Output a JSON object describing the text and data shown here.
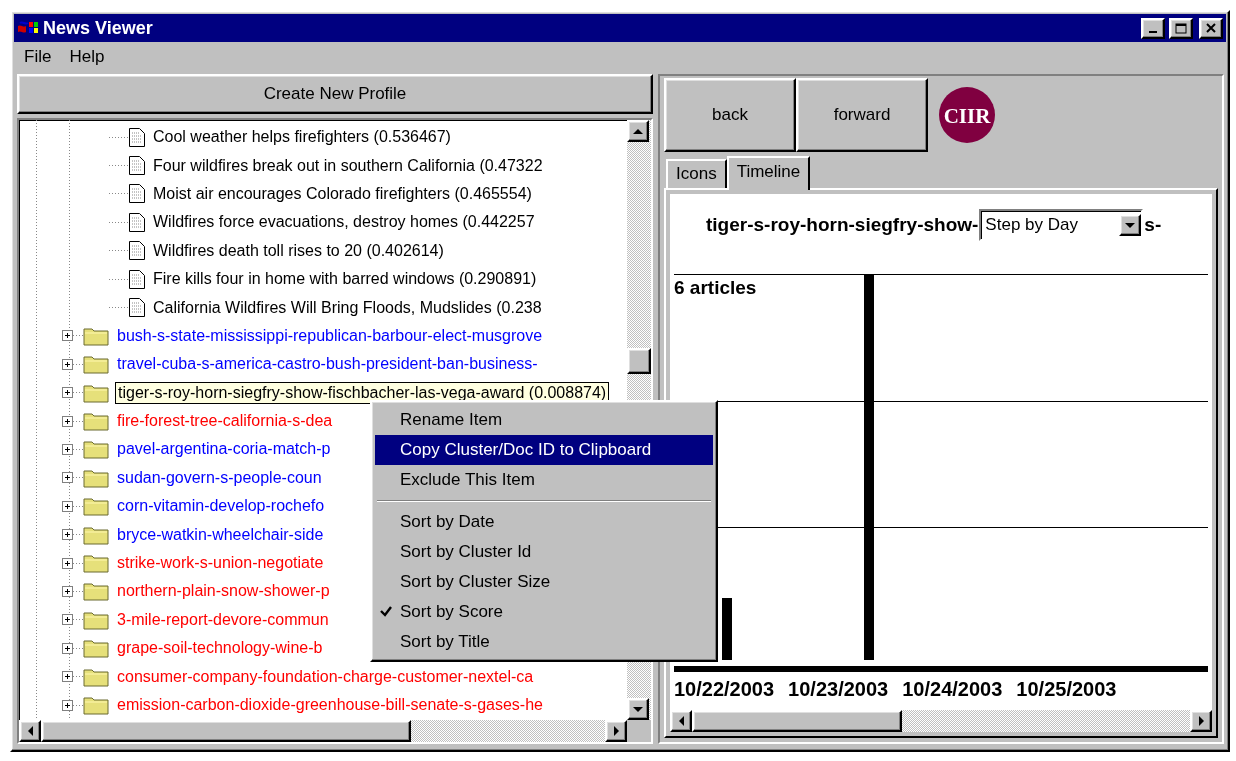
{
  "window": {
    "title": "News Viewer"
  },
  "menu_bar": [
    "File",
    "Help"
  ],
  "create_button": "Create New Profile",
  "tree": {
    "documents": [
      {
        "label": "Cool weather helps firefighters (0.536467)"
      },
      {
        "label": "Four wildfires break out in southern California (0.47322"
      },
      {
        "label": "Moist air encourages Colorado firefighters (0.465554)"
      },
      {
        "label": "Wildfires force evacuations, destroy homes (0.442257"
      },
      {
        "label": "Wildfires death toll rises to 20 (0.402614)"
      },
      {
        "label": "Fire kills four in home with barred windows (0.290891)"
      },
      {
        "label": "California Wildfires Will Bring Floods, Mudslides (0.238"
      }
    ],
    "clusters": [
      {
        "label": "bush-s-state-mississippi-republican-barbour-elect-musgrove",
        "color": "#0000ff",
        "expanded": false,
        "selected": false
      },
      {
        "label": "travel-cuba-s-america-castro-bush-president-ban-business-",
        "color": "#0000ff",
        "expanded": false,
        "selected": false
      },
      {
        "label": "tiger-s-roy-horn-siegfry-show-fischbacher-las-vega-award (0.008874)",
        "color": "#000000",
        "expanded": false,
        "selected": true
      },
      {
        "label": "fire-forest-tree-california-s-dea",
        "color": "#ff0000",
        "expanded": false,
        "selected": false
      },
      {
        "label": "pavel-argentina-coria-match-p",
        "color": "#0000ff",
        "expanded": false,
        "selected": false
      },
      {
        "label": "sudan-govern-s-people-coun",
        "color": "#0000ff",
        "expanded": false,
        "selected": false
      },
      {
        "label": "corn-vitamin-develop-rochefo",
        "color": "#0000ff",
        "expanded": false,
        "selected": false
      },
      {
        "label": "bryce-watkin-wheelchair-side",
        "color": "#0000ff",
        "expanded": false,
        "selected": false
      },
      {
        "label": "strike-work-s-union-negotiate",
        "color": "#ff0000",
        "expanded": false,
        "selected": false
      },
      {
        "label": "northern-plain-snow-shower-p",
        "color": "#ff0000",
        "expanded": false,
        "selected": false
      },
      {
        "label": "3-mile-report-devore-commun",
        "color": "#ff0000",
        "expanded": false,
        "selected": false
      },
      {
        "label": "grape-soil-technology-wine-b",
        "color": "#ff0000",
        "expanded": false,
        "selected": false
      },
      {
        "label": "consumer-company-foundation-charge-customer-nextel-ca",
        "color": "#ff0000",
        "expanded": false,
        "selected": false
      },
      {
        "label": "emission-carbon-dioxide-greenhouse-bill-senate-s-gases-he",
        "color": "#ff0000",
        "expanded": false,
        "selected": false
      }
    ]
  },
  "context_menu": [
    {
      "kind": "item",
      "label": "Rename Item",
      "selected": false,
      "checked": false
    },
    {
      "kind": "item",
      "label": "Copy Cluster/Doc ID to Clipboard",
      "selected": true,
      "checked": false
    },
    {
      "kind": "item",
      "label": "Exclude This Item",
      "selected": false,
      "checked": false
    },
    {
      "kind": "separator"
    },
    {
      "kind": "item",
      "label": "Sort by Date",
      "selected": false,
      "checked": false
    },
    {
      "kind": "item",
      "label": "Sort by Cluster Id",
      "selected": false,
      "checked": false
    },
    {
      "kind": "item",
      "label": "Sort by Cluster Size",
      "selected": false,
      "checked": false
    },
    {
      "kind": "item",
      "label": "Sort by Score",
      "selected": false,
      "checked": true
    },
    {
      "kind": "item",
      "label": "Sort by Title",
      "selected": false,
      "checked": false
    }
  ],
  "nav_buttons": [
    "back",
    "forward"
  ],
  "logo": "CIIR",
  "tabs": [
    {
      "label": "Icons",
      "selected": false
    },
    {
      "label": "Timeline",
      "selected": true
    }
  ],
  "timeline": {
    "title": "tiger-s-roy-horn-siegfry-show-",
    "title_tail": "s-",
    "step_select": "Step by Day",
    "max_label": "6 articles",
    "dates": [
      "10/22/2003",
      "10/23/2003",
      "10/24/2003",
      "10/25/2003"
    ]
  }
}
